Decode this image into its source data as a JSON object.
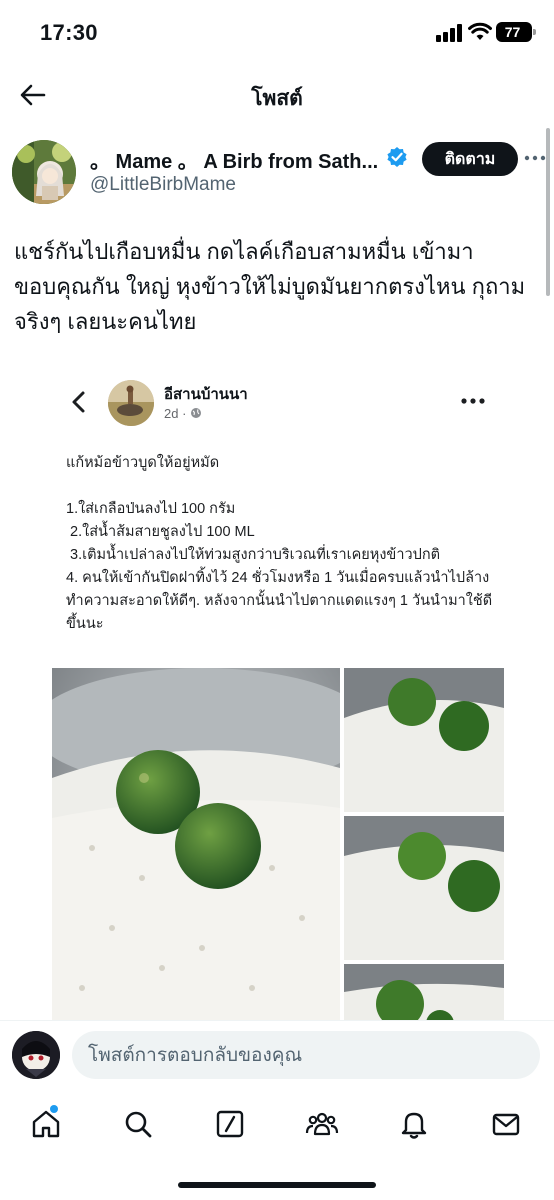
{
  "status_bar": {
    "time": "17:30",
    "battery": "77"
  },
  "header": {
    "title": "โพสต์"
  },
  "author": {
    "display_name": "。 Mame 。 A Birb from Sath...",
    "handle": "@LittleBirbMame",
    "follow_label": "ติดตาม",
    "verified": true
  },
  "tweet": {
    "text": "แชร์กันไปเกือบหมื่น กดไลค์เกือบสามหมื่น เข้ามาขอบคุณกัน ใหญ่ หุงข้าวให้ไม่บูดมันยากตรงไหน กุถามจริงๆ เลยนะคนไทย"
  },
  "embedded_post": {
    "page_name": "อีสานบ้านนา",
    "meta": "2d · ",
    "body": "แก้หม้อข้าวบูดให้อยู่หมัด\n\n1.ใส่เกลือป่นลงไป 100 กรัม\n 2.ใส่น้ำส้มสายชูลงไป 100 ML\n 3.เติมน้ำเปล่าลงไปให้ท่วมสูงกว่าบริเวณที่เราเคยหุงข้าวปกติ\n4. คนให้เข้ากันปิดฝาทิ้งไว้ 24 ชั่วโมงหรือ 1 วันเมื่อครบแล้วนำไปล้างทำความสะอาดให้ดีๆ. หลังจากนั้นนำไปตากแดดแรงๆ 1 วันนำมาใช้ดีขึ้นนะ"
  },
  "reply": {
    "placeholder": "โพสต์การตอบกลับของคุณ"
  },
  "tabs": [
    "home-icon",
    "search-icon",
    "grok-icon",
    "communities-icon",
    "notifications-icon",
    "messages-icon"
  ],
  "colors": {
    "accent": "#1d9bf0",
    "text": "#0f1419",
    "muted": "#536471",
    "follow_bg": "#0f1419"
  }
}
